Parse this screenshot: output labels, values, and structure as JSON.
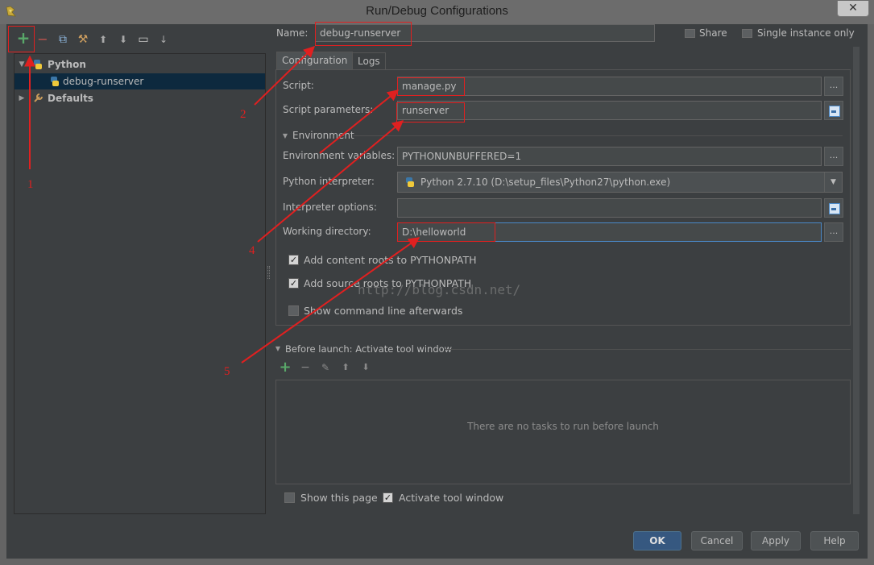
{
  "window": {
    "title": "Run/Debug Configurations",
    "close_glyph": "✕"
  },
  "toolbar": {
    "add": "+",
    "remove": "−",
    "copy": "⧉",
    "edit_defaults": "⚒",
    "move_up": "⬆",
    "move_down": "⬇",
    "folder": "▭",
    "sort": "↓"
  },
  "tree": {
    "python_label": "Python",
    "item_label": "debug-runserver",
    "defaults_label": "Defaults"
  },
  "header": {
    "name_label": "Name:",
    "name_value": "debug-runserver",
    "share_label": "Share",
    "single_instance_label": "Single instance only"
  },
  "tabs": [
    {
      "label": "Configuration"
    },
    {
      "label": "Logs"
    }
  ],
  "config": {
    "script_label": "Script:",
    "script_value": "manage.py",
    "params_label": "Script parameters:",
    "params_value": "runserver",
    "environment_label": "Environment",
    "env_vars_label": "Environment variables:",
    "env_vars_value": "PYTHONUNBUFFERED=1",
    "interpreter_label": "Python interpreter:",
    "interpreter_value": "Python 2.7.10 (D:\\setup_files\\Python27\\python.exe)",
    "interp_options_label": "Interpreter options:",
    "interp_options_value": "",
    "workdir_label": "Working directory:",
    "workdir_value": "D:\\helloworld",
    "add_content_roots_label": "Add content roots to PYTHONPATH",
    "add_source_roots_label": "Add source roots to PYTHONPATH",
    "show_cmdline_label": "Show command line afterwards",
    "browse_glyph": "...",
    "dropdown_glyph": "▼"
  },
  "before_launch": {
    "label": "Before launch: Activate tool window",
    "add": "+",
    "remove": "−",
    "edit": "✎",
    "up": "⬆",
    "down": "⬇",
    "empty_message": "There are no tasks to run before launch",
    "show_page_label": "Show this page",
    "activate_label": "Activate tool window"
  },
  "buttons": {
    "ok": "OK",
    "cancel": "Cancel",
    "apply": "Apply",
    "help": "Help"
  },
  "annotations": {
    "n1": "1",
    "n2": "2",
    "n4": "4",
    "n5": "5"
  },
  "watermark": "http://blog.csdn.net/",
  "colors": {
    "accent": "#4a88c7",
    "selection": "#0d293e",
    "annotation_red": "#e02020",
    "add_green": "#59a869"
  }
}
